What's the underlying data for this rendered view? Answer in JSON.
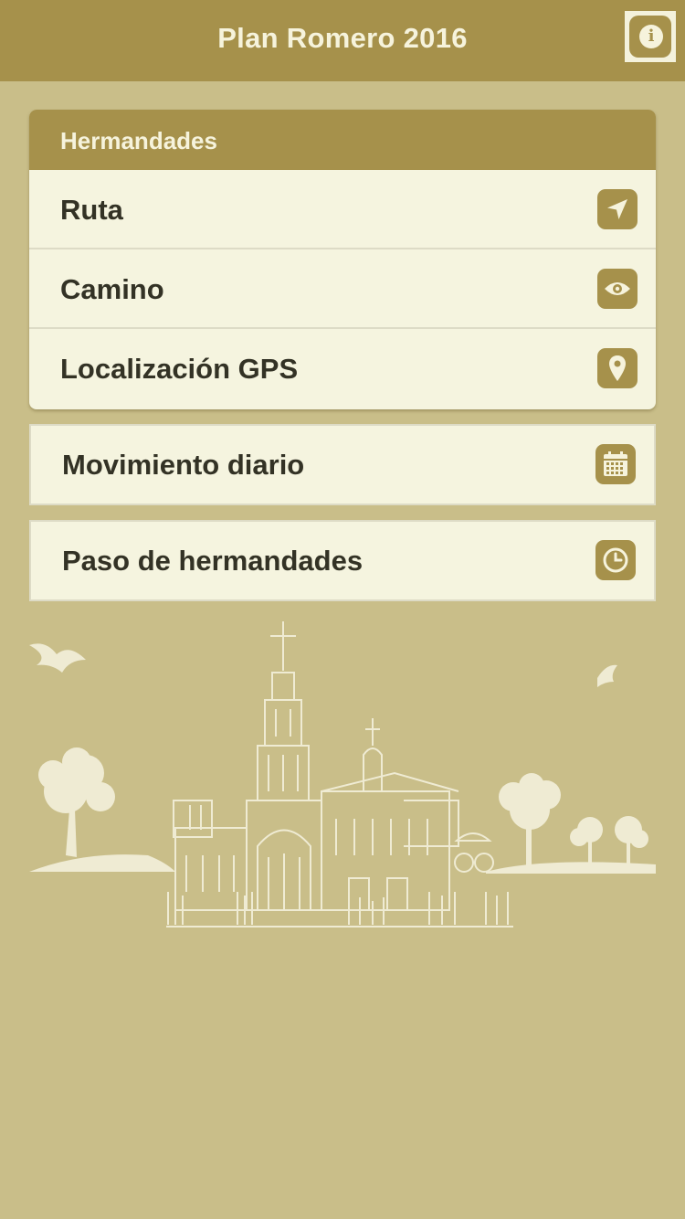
{
  "app": {
    "title": "Plan Romero 2016"
  },
  "header": {
    "info_icon": "info-icon",
    "info_glyph": "i"
  },
  "group": {
    "title": "Hermandades",
    "items": [
      {
        "label": "Ruta",
        "icon": "navigation-arrow-icon"
      },
      {
        "label": "Camino",
        "icon": "eye-icon"
      },
      {
        "label": "Localización GPS",
        "icon": "map-pin-icon"
      }
    ]
  },
  "menu": [
    {
      "label": "Movimiento diario",
      "icon": "calendar-icon"
    },
    {
      "label": "Paso de hermandades",
      "icon": "clock-icon"
    }
  ],
  "colors": {
    "background": "#c9be89",
    "accent": "#a6914b",
    "card": "#f5f4df",
    "text": "#333225"
  }
}
